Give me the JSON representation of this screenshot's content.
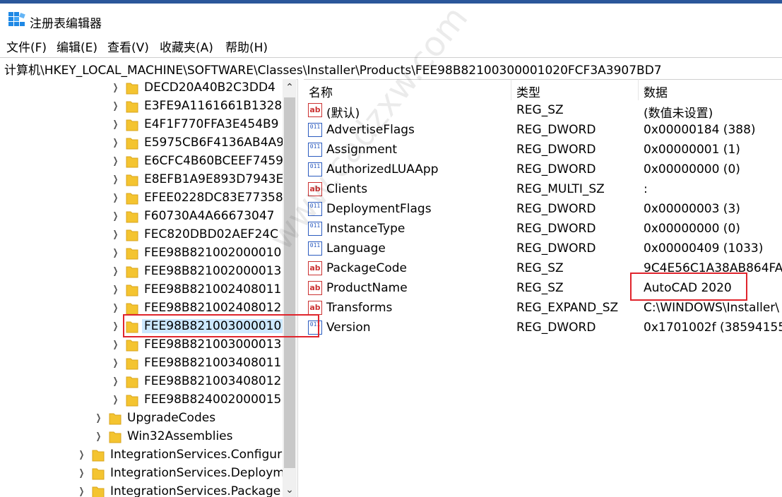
{
  "window": {
    "title": "注册表编辑器"
  },
  "menu": [
    "文件(F)",
    "编辑(E)",
    "查看(V)",
    "收藏夹(A)",
    "帮助(H)"
  ],
  "address": "计算机\\HKEY_LOCAL_MACHINE\\SOFTWARE\\Classes\\Installer\\Products\\FEE98B82100300001020FCF3A3907BD7",
  "tree": [
    {
      "label": "DECD20A40B2C3DD4",
      "selected": false
    },
    {
      "label": "E3FE9A1161661B1328",
      "selected": false
    },
    {
      "label": "E4F1F770FFA3E454B9",
      "selected": false
    },
    {
      "label": "E5975CB6F4136AB4A9",
      "selected": false
    },
    {
      "label": "E6CFC4B60BCEEF7459",
      "selected": false
    },
    {
      "label": "E8EFB1A9E893D7943E",
      "selected": false
    },
    {
      "label": "EFEE0228DC83E77358",
      "selected": false
    },
    {
      "label": "F60730A4A66673047",
      "selected": false
    },
    {
      "label": "FEC820DBD02AEF24C",
      "selected": false
    },
    {
      "label": "FEE98B821002000010",
      "selected": false
    },
    {
      "label": "FEE98B821002000013",
      "selected": false
    },
    {
      "label": "FEE98B821002408011",
      "selected": false
    },
    {
      "label": "FEE98B821002408012",
      "selected": false
    },
    {
      "label": "FEE98B821003000010",
      "selected": true
    },
    {
      "label": "FEE98B821003000013",
      "selected": false
    },
    {
      "label": "FEE98B821003408011",
      "selected": false
    },
    {
      "label": "FEE98B821003408012",
      "selected": false
    },
    {
      "label": "FEE98B824002000015",
      "selected": false
    },
    {
      "label": "UpgradeCodes",
      "selected": false
    },
    {
      "label": "Win32Assemblies",
      "selected": false
    },
    {
      "label": "IntegrationServices.Configur",
      "selected": false
    },
    {
      "label": "IntegrationServices.Deploym",
      "selected": false
    },
    {
      "label": "IntegrationServices.Package",
      "selected": false
    }
  ],
  "columns": {
    "name": "名称",
    "type": "类型",
    "data": "数据"
  },
  "values": [
    {
      "name": "(默认)",
      "type": "REG_SZ",
      "data": "(数值未设置)",
      "icon": "string-icon"
    },
    {
      "name": "AdvertiseFlags",
      "type": "REG_DWORD",
      "data": "0x00000184 (388)",
      "icon": "binary-icon"
    },
    {
      "name": "Assignment",
      "type": "REG_DWORD",
      "data": "0x00000001 (1)",
      "icon": "binary-icon"
    },
    {
      "name": "AuthorizedLUAApp",
      "type": "REG_DWORD",
      "data": "0x00000000 (0)",
      "icon": "binary-icon"
    },
    {
      "name": "Clients",
      "type": "REG_MULTI_SZ",
      "data": ":",
      "icon": "string-icon"
    },
    {
      "name": "DeploymentFlags",
      "type": "REG_DWORD",
      "data": "0x00000003 (3)",
      "icon": "binary-icon"
    },
    {
      "name": "InstanceType",
      "type": "REG_DWORD",
      "data": "0x00000000 (0)",
      "icon": "binary-icon"
    },
    {
      "name": "Language",
      "type": "REG_DWORD",
      "data": "0x00000409 (1033)",
      "icon": "binary-icon"
    },
    {
      "name": "PackageCode",
      "type": "REG_SZ",
      "data": "9C4E56C1A38AB864FA",
      "icon": "string-icon"
    },
    {
      "name": "ProductName",
      "type": "REG_SZ",
      "data": "AutoCAD 2020",
      "icon": "string-icon"
    },
    {
      "name": "Transforms",
      "type": "REG_EXPAND_SZ",
      "data": "C:\\WINDOWS\\Installer\\",
      "icon": "string-icon"
    },
    {
      "name": "Version",
      "type": "REG_DWORD",
      "data": "0x1701002f (38594155",
      "icon": "binary-icon"
    }
  ],
  "icon_labels": {
    "string": "ab",
    "binary": "011"
  },
  "watermark": "www.cadzxw.com",
  "colors": {
    "highlight_box": "#e0242c",
    "title_accent": "#2b579a"
  }
}
